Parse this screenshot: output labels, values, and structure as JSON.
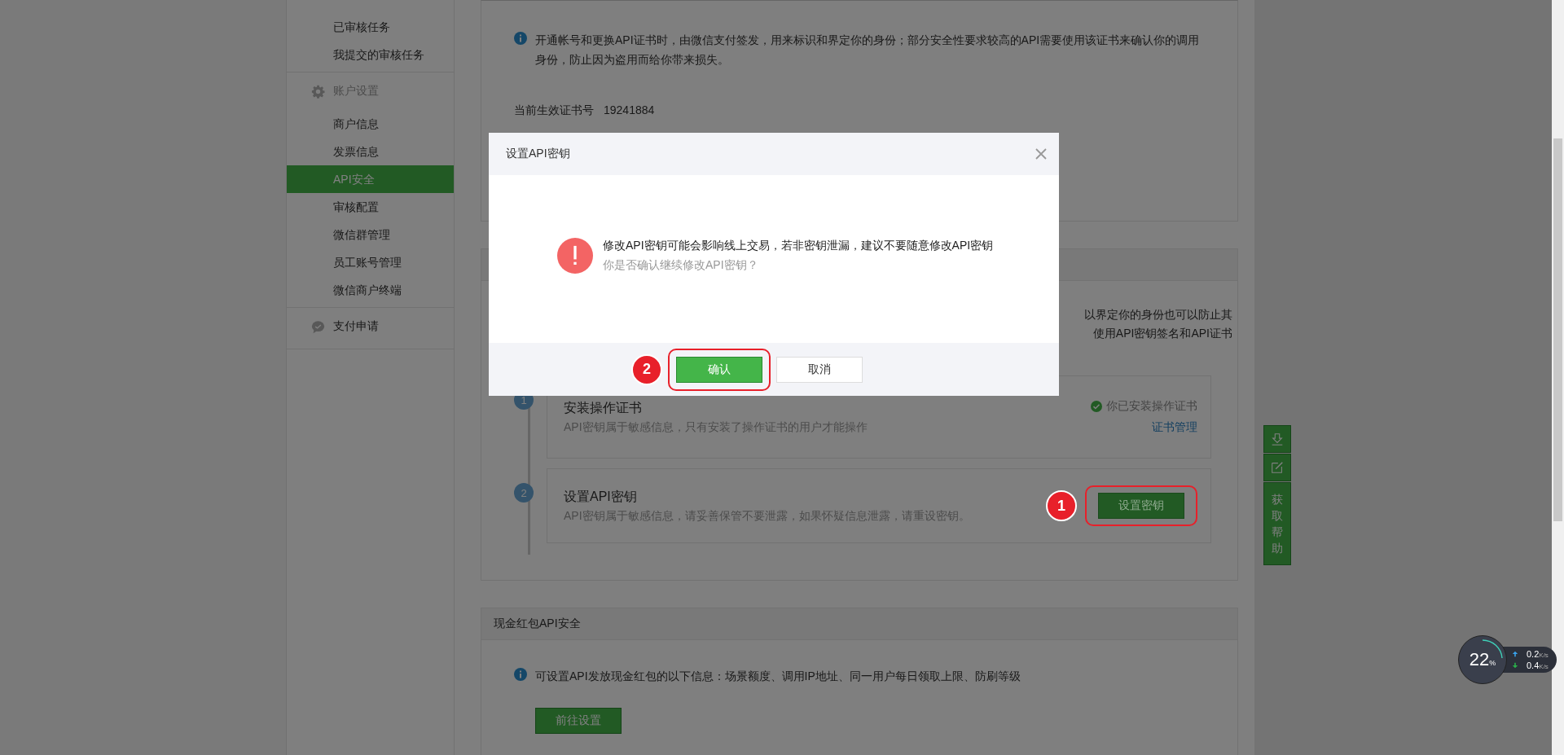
{
  "sidebar": {
    "groups": [
      {
        "items": [
          {
            "label": "已审核任务",
            "selected": false
          },
          {
            "label": "我提交的审核任务",
            "selected": false
          }
        ]
      },
      {
        "title": "账户设置",
        "items": [
          {
            "label": "商户信息",
            "selected": false
          },
          {
            "label": "发票信息",
            "selected": false
          },
          {
            "label": "API安全",
            "selected": true
          },
          {
            "label": "审核配置",
            "selected": false
          },
          {
            "label": "微信群管理",
            "selected": false
          },
          {
            "label": "员工账号管理",
            "selected": false
          },
          {
            "label": "微信商户终端",
            "selected": false
          }
        ]
      },
      {
        "title": "支付申请"
      }
    ]
  },
  "cert_section": {
    "notice": "开通帐号和更换API证书时，由微信支付签发，用来标识和界定你的身份；部分安全性要求较高的API需要使用该证书来确认你的调用身份，防止因为盗用而给你带来损失。",
    "serial_label": "当前生效证书号",
    "serial": "19241884"
  },
  "key_section": {
    "intro_lines": [
      "以界定你的身份也可以防止其",
      "使用API密钥签名和API证书"
    ],
    "steps": [
      {
        "number": "1",
        "title": "安装操作证书",
        "desc": "API密钥属于敏感信息，只有安装了操作证书的用户才能操作",
        "status": "你已安装操作证书",
        "link": "证书管理"
      },
      {
        "number": "2",
        "title": "设置API密钥",
        "desc": "API密钥属于敏感信息，请妥善保管不要泄露，如果怀疑信息泄露，请重设密钥。",
        "button": "设置密钥",
        "marker": "1"
      }
    ]
  },
  "redpack_section": {
    "title": "现金红包API安全",
    "notice": "可设置API发放现金红包的以下信息：场景额度、调用IP地址、同一用户每日领取上限、防刷等级",
    "button": "前往设置"
  },
  "help_bar": {
    "label": "获取帮助"
  },
  "dialog": {
    "title": "设置API密钥",
    "message": "修改API密钥可能会影响线上交易，若非密钥泄漏，建议不要随意修改API密钥",
    "question": "你是否确认继续修改API密钥？",
    "confirm": "确认",
    "cancel": "取消",
    "marker": "2"
  },
  "net_widget": {
    "percent": "22",
    "percent_unit": "%",
    "up": "0.2",
    "up_unit": "K/s",
    "down": "0.4",
    "down_unit": "K/s"
  }
}
